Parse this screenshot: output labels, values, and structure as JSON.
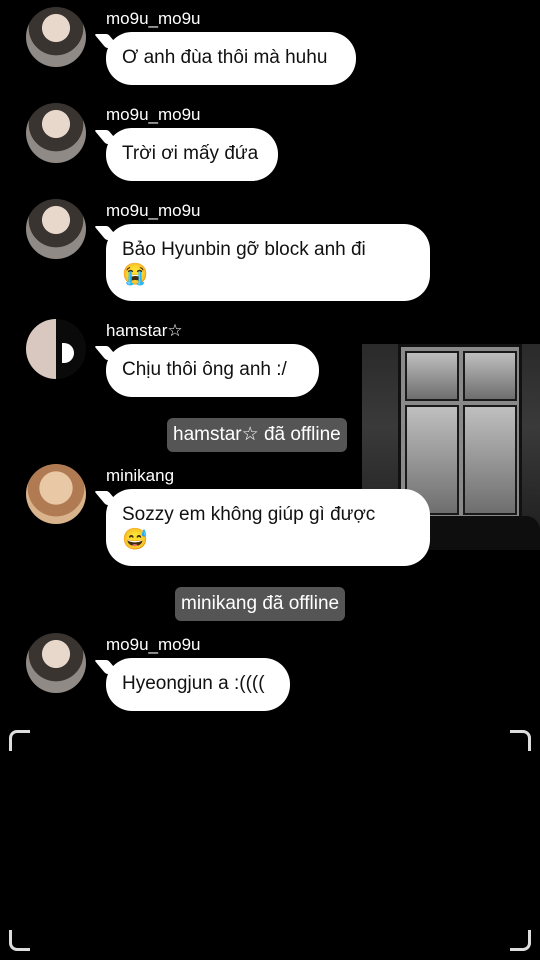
{
  "messages": [
    {
      "sender": "mo9u_mo9u",
      "text": "Ơ anh đùa thôi mà huhu"
    },
    {
      "sender": "mo9u_mo9u",
      "text": "Trời ơi mấy đứa"
    },
    {
      "sender": "mo9u_mo9u",
      "text": "Bảo Hyunbin gỡ block anh đi",
      "emoji": "😭"
    },
    {
      "sender": "hamstar☆",
      "text": "Chịu thôi ông anh :/"
    },
    {
      "sender": "minikang",
      "text": "Sozzy em không giúp gì được",
      "emoji": "😅"
    },
    {
      "sender": "mo9u_mo9u",
      "text": "Hyeongjun a :(((("
    }
  ],
  "system_notices": [
    {
      "text": "hamstar☆ đã offline"
    },
    {
      "text": "minikang đã offline"
    }
  ],
  "icons": {
    "viewfinder": "corner-bracket-icon"
  }
}
